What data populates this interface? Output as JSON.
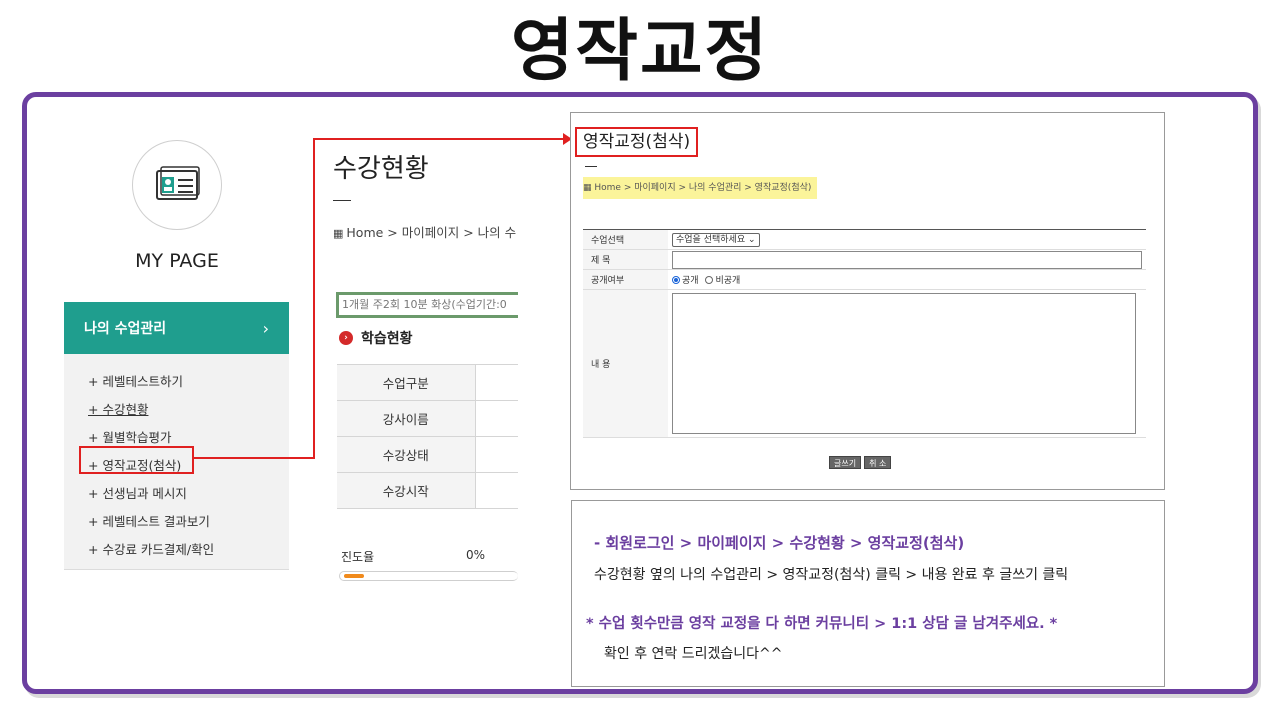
{
  "heading": "영작교정",
  "mypage": {
    "label": "MY PAGE",
    "icon": "id-card-icon"
  },
  "sidebar": {
    "header": "나의 수업관리",
    "chevron": "›",
    "items": [
      "+ 레벨테스트하기",
      "+ 수강현황",
      "+ 월별학습평가",
      "+ 영작교정(첨삭)",
      "+ 선생님과 메시지",
      "+ 레벨테스트 결과보기",
      "+ 수강료 카드결제/확인"
    ]
  },
  "status_page": {
    "title": "수강현황",
    "dash": "—",
    "breadcrumb": "Home > 마이페이지 > 나의 수",
    "info": "1개월 주2회 10분 화상(수업기간:0",
    "section": "학습현황",
    "rows": [
      "수업구분",
      "강사이름",
      "수강상태",
      "수강시작"
    ],
    "progress_label": "진도율",
    "progress_value": "0%",
    "progress_fraction": 0.05
  },
  "form": {
    "title": "영작교정(첨삭)",
    "dash": "—",
    "breadcrumb": "Home > 마이페이지 > 나의 수업관리 > 영작교정(첨삭)",
    "fields": {
      "class_label": "수업선택",
      "class_select": "수업을 선택하세요",
      "subject_label": "제 목",
      "public_label": "공개여부",
      "public_option": "공개",
      "private_option": "비공개",
      "content_label": "내 용"
    },
    "write_button": "글쓰기",
    "cancel_button": "취 소"
  },
  "note": {
    "line1": "- 회원로그인 > 마이페이지 > 수강현황 > 영작교정(첨삭)",
    "line2": "수강현황 옆의 나의 수업관리 > 영작교정(첨삭) 클릭 > 내용 완료 후 글쓰기 클릭",
    "line3": "* 수업 횟수만큼 영작 교정을 다 하면 커뮤니티 > 1:1 상담 글 남겨주세요. *",
    "line4": "확인 후 연락 드리겠습니다^^"
  },
  "colors": {
    "frame": "#6b3fa0",
    "sidebar_header": "#1f9e8e",
    "highlight": "#e02020",
    "progress": "#f08a1c",
    "breadcrumb_highlight": "#fbf49a"
  }
}
